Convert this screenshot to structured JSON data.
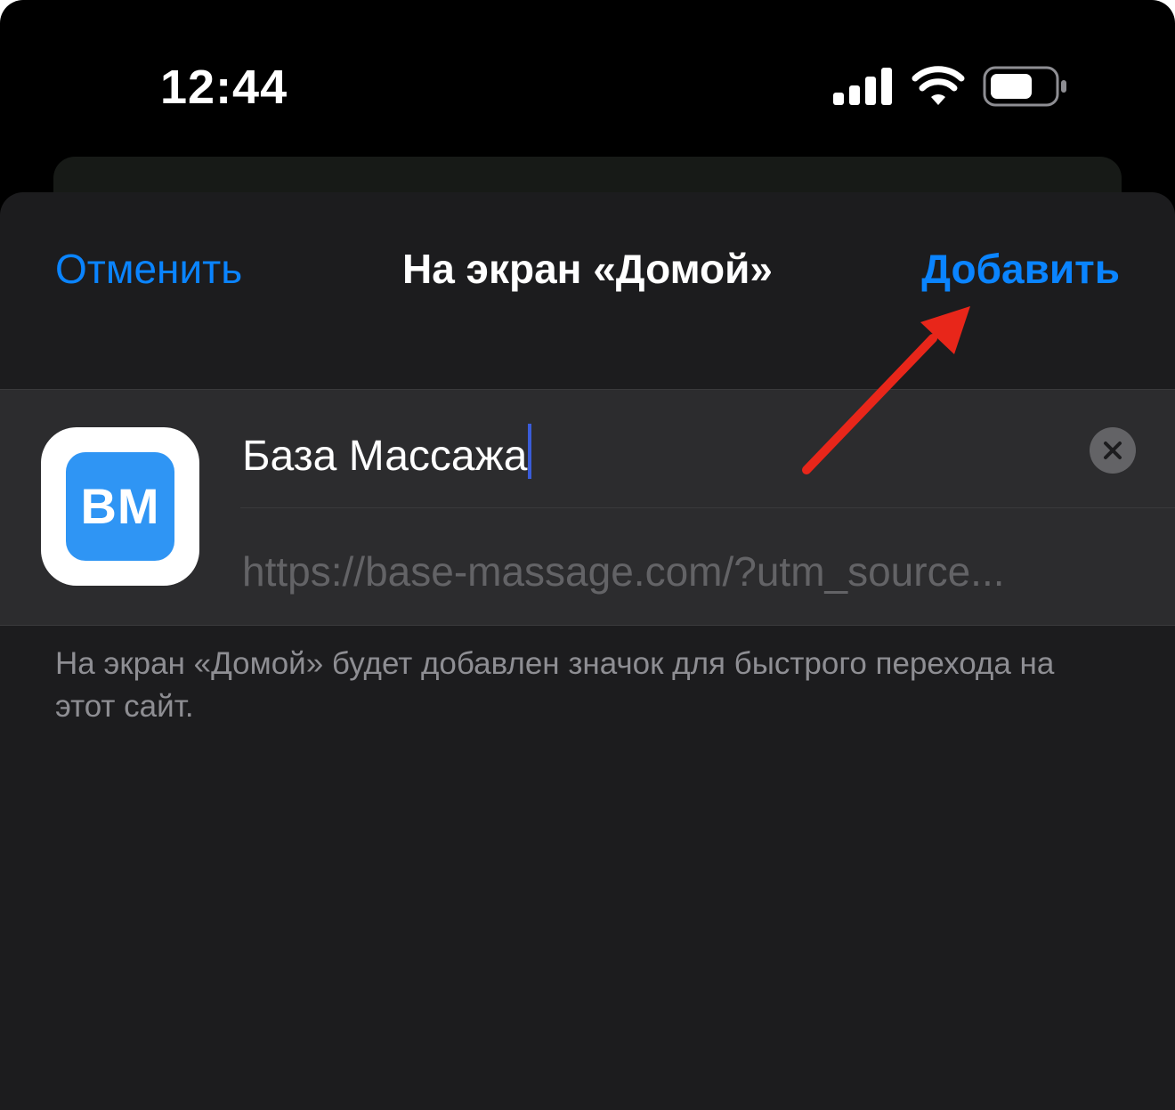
{
  "status_bar": {
    "time": "12:44"
  },
  "sheet": {
    "cancel_label": "Отменить",
    "title": "На экран «Домой»",
    "add_label": "Добавить"
  },
  "app_icon": {
    "text": "BM",
    "color": "#2f95f4"
  },
  "form": {
    "name_value": "База Массажа",
    "url_value": "https://base-massage.com/?utm_source..."
  },
  "footer_note": "На экран «Домой» будет добавлен значок для быстрого перехода на этот сайт.",
  "colors": {
    "accent": "#0a84ff",
    "annotation_arrow": "#e8261a"
  }
}
